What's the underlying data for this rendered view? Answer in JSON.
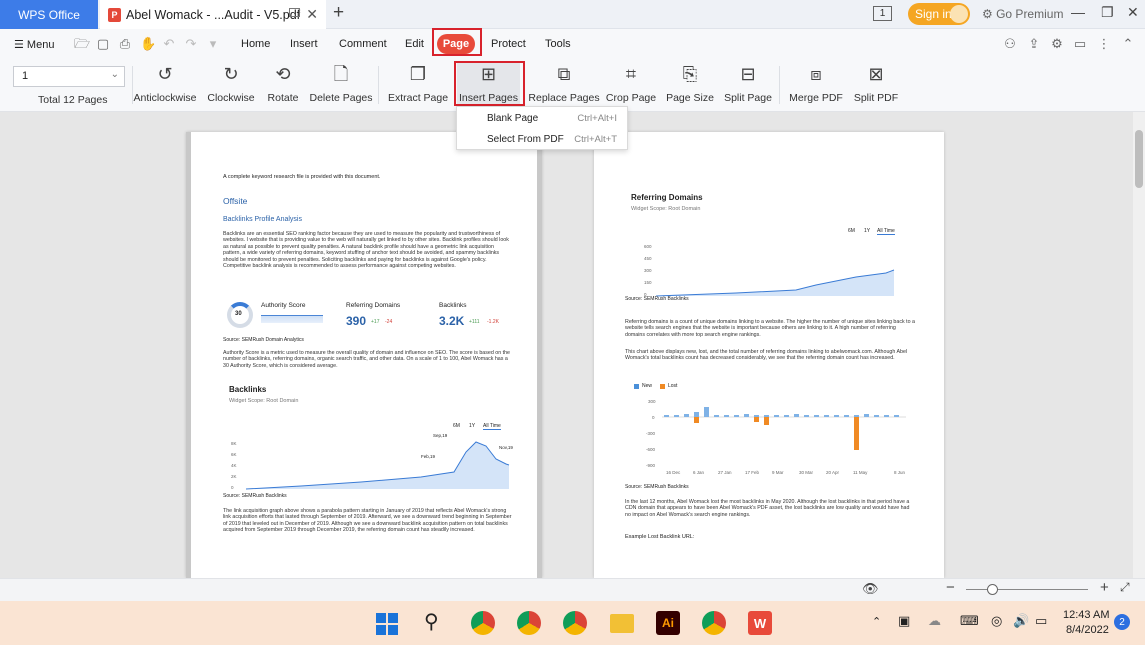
{
  "titlebar": {
    "app_tab": "WPS Office",
    "doc_tab": "Abel Womack - ...Audit - V5.pdf",
    "new_tab": "+",
    "page_count_badge": "1",
    "signin": "Sign in",
    "premium": "Go Premium"
  },
  "menubar": {
    "menu": "Menu",
    "tabs": [
      "Home",
      "Insert",
      "Comment",
      "Edit",
      "Page",
      "Protect",
      "Tools"
    ]
  },
  "toolbar": {
    "page_value": "1",
    "total_pages": "Total 12 Pages",
    "buttons": [
      "Anticlockwise",
      "Clockwise",
      "Rotate",
      "Delete Pages",
      "Extract Page",
      "Insert Pages",
      "Replace Pages",
      "Crop Page",
      "Page Size",
      "Split Page",
      "Merge PDF",
      "Split PDF"
    ]
  },
  "dropdown": {
    "items": [
      {
        "label": "Blank Page",
        "shortcut": "Ctrl+Alt+I"
      },
      {
        "label": "Select From PDF",
        "shortcut": "Ctrl+Alt+T"
      }
    ]
  },
  "page_left": {
    "intro": "A complete keyword research file is provided with this document.",
    "offsite": "Offsite",
    "backlinks_profile": "Backlinks Profile Analysis",
    "para1": "Backlinks are an essential SEO ranking factor because they are used to measure the popularity and trustworthiness of websites. I website that is providing value to the web will naturally get linked to by other sites. Backlink profiles should look as natural as possible to prevent quality penalties. A natural backlink profile should have a geometric link acquisition pattern, a wide variety of referring domains, keyword stuffing of anchor text should be avoided, and spammy backlinks should be monitored to prevent penalties. Soliciting backlinks and paying for backlinks is against Google's policy. Competitive backlink analysis is recommended to assess performance against competing websites.",
    "authority_label": "Authority Score",
    "authority_value": "30",
    "referring_label": "Referring Domains",
    "referring_value": "390",
    "referring_up": "+17",
    "referring_down": "-24",
    "backlinks_label": "Backlinks",
    "backlinks_value": "3.2K",
    "backlinks_up": "+111",
    "backlinks_down": "-1.2K",
    "source1": "Source: SEMRush Domain Analytics",
    "para2": "Authority Score is a metric used to measure the overall quality of domain and influence on SEO. The score is based on the number of backlinks, referring domains, organic search traffic, and other data. On a scale of 1 to 100, Abel Womack has a 30 Authority Score, which is considered average.",
    "backlinks_title": "Backlinks",
    "widget_scope": "Widget Scope: Root Domain",
    "ranges": [
      "6M",
      "1Y",
      "All Time"
    ],
    "yticks": [
      "8K",
      "6K",
      "4K",
      "2K",
      "0"
    ],
    "annotations": [
      "Sep,19",
      "Feb,19",
      "Nov,19"
    ],
    "source2": "Source: SEMRush Backlinks",
    "para3": "The link acquisition graph above shows a parabola pattern starting in January of 2019 that reflects Abel Womack's strong link acquisition efforts that lasted through September of 2019. Afterward, we see a downward trend beginning in September of 2019 that leveled out in December of 2019. Although we see a downward backlink acquisition pattern on total backlinks acquired from September 2019 through December 2019, the referring domain count has steadily increased."
  },
  "page_right": {
    "title": "Referring Domains",
    "widget_scope": "Widget Scope: Root Domain",
    "ranges": [
      "6M",
      "1Y",
      "All Time"
    ],
    "yticks1": [
      "600",
      "450",
      "300",
      "150",
      "0"
    ],
    "source1": "Source: SEMRush Backlinks",
    "para1": "Referring domains is a count of unique domains linking to a website. The higher the number of unique sites linking back to a website tells search engines that the website is important because others are linking to it. A high number of referring domains correlates with more top search engine rankings.",
    "para2": "This chart above displays new, lost, and the total number of referring domains linking to abelwomack.com. Although Abel Womack's total backlinks count has decreased considerably, we see that the referring domain count has increased.",
    "legend_new": "New",
    "legend_lost": "Lost",
    "yticks2": [
      "300",
      "0",
      "-300",
      "-600",
      "-900"
    ],
    "xticks2": [
      "16 Dec",
      "6 Jan",
      "27 Jan",
      "17 Feb",
      "9 Mar",
      "30 Mar",
      "20 Apr",
      "11 May",
      "8 Jun"
    ],
    "source2": "Source: SEMRush Backlinks",
    "para3": "In the last 12 months, Abel Womack lost the most backlinks in May 2020. Although the lost backlinks in that period have a CDN domain that appears to have been Abel Womack's PDF asset, the lost backlinks are low quality and would have had no impact on Abel Womack's search engine rankings.",
    "example": "Example Lost Backlink URL:"
  },
  "taskbar": {
    "time": "12:43 AM",
    "date": "8/4/2022",
    "notif": "2"
  },
  "colors": {
    "accent": "#3d7ce8",
    "page_tab": "#e84a3a",
    "highlight": "#d8222c"
  }
}
